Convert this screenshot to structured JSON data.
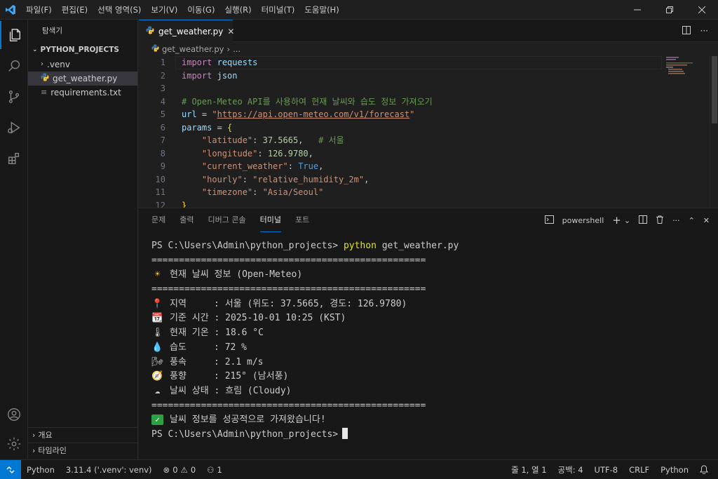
{
  "menu": [
    "파일(F)",
    "편집(E)",
    "선택 영역(S)",
    "보기(V)",
    "이동(G)",
    "실행(R)",
    "터미널(T)",
    "도움말(H)"
  ],
  "sidebar": {
    "title": "탐색기",
    "project": "PYTHON_PROJECTS",
    "items": [
      ".venv",
      "get_weather.py",
      "requirements.txt"
    ],
    "bottom": [
      "개요",
      "타임라인"
    ]
  },
  "editor": {
    "tab": "get_weather.py",
    "breadcrumb_file": "get_weather.py",
    "breadcrumb_more": "...",
    "lines": [
      [
        [
          "kw",
          "import"
        ],
        [
          "pl",
          " "
        ],
        [
          "id",
          "requests"
        ]
      ],
      [
        [
          "kw",
          "import"
        ],
        [
          "pl",
          " "
        ],
        [
          "id",
          "json"
        ]
      ],
      [],
      [
        [
          "cm",
          "# Open-Meteo API를 사용하여 현재 날씨와 습도 정보 가져오기"
        ]
      ],
      [
        [
          "id",
          "url"
        ],
        [
          "pl",
          " = "
        ],
        [
          "str",
          "\""
        ],
        [
          "url",
          "https://api.open-meteo.com/v1/forecast"
        ],
        [
          "str",
          "\""
        ]
      ],
      [
        [
          "id",
          "params"
        ],
        [
          "pl",
          " = "
        ],
        [
          "br",
          "{"
        ]
      ],
      [
        [
          "pl",
          "    "
        ],
        [
          "str",
          "\"latitude\""
        ],
        [
          "pl",
          ": "
        ],
        [
          "num",
          "37.5665"
        ],
        [
          "pl",
          ",   "
        ],
        [
          "cm",
          "# 서울"
        ]
      ],
      [
        [
          "pl",
          "    "
        ],
        [
          "str",
          "\"longitude\""
        ],
        [
          "pl",
          ": "
        ],
        [
          "num",
          "126.9780"
        ],
        [
          "pl",
          ","
        ]
      ],
      [
        [
          "pl",
          "    "
        ],
        [
          "str",
          "\"current_weather\""
        ],
        [
          "pl",
          ": "
        ],
        [
          "bool",
          "True"
        ],
        [
          "pl",
          ","
        ]
      ],
      [
        [
          "pl",
          "    "
        ],
        [
          "str",
          "\"hourly\""
        ],
        [
          "pl",
          ": "
        ],
        [
          "str",
          "\"relative_humidity_2m\""
        ],
        [
          "pl",
          ","
        ]
      ],
      [
        [
          "pl",
          "    "
        ],
        [
          "str",
          "\"timezone\""
        ],
        [
          "pl",
          ": "
        ],
        [
          "str",
          "\"Asia/Seoul\""
        ]
      ],
      [
        [
          "br",
          "}"
        ]
      ]
    ]
  },
  "panel": {
    "tabs": [
      "문제",
      "출력",
      "디버그 콘솔",
      "터미널",
      "포트"
    ],
    "active_tab": "터미널",
    "shell": "powershell"
  },
  "terminal": {
    "prompt": "PS C:\\Users\\Admin\\python_projects> ",
    "command": "python",
    "args": " get_weather.py",
    "separator": "==================================================",
    "header": "현재 날씨 정보 (Open-Meteo)",
    "rows": [
      {
        "icon": "📍",
        "text": "지역     : 서울 (위도: 37.5665, 경도: 126.9780)"
      },
      {
        "icon": "📆",
        "text": "기준 시간 : 2025-10-01 10:25 (KST)"
      },
      {
        "icon": "🌡",
        "text": "현재 기온 : 18.6 °C"
      },
      {
        "icon": "💧",
        "text": "습도     : 72 %"
      },
      {
        "icon": "🌬",
        "text": "풍속     : 2.1 m/s"
      },
      {
        "icon": "🧭",
        "text": "풍향     : 215° (남서풍)"
      },
      {
        "icon": "☁",
        "text": "날씨 상태 : 흐림 (Cloudy)"
      }
    ],
    "success": "날씨 정보를 성공적으로 가져왔습니다!",
    "final_prompt": "PS C:\\Users\\Admin\\python_projects>"
  },
  "status": {
    "language_left": "Python",
    "interpreter": "3.11.4 ('.venv': venv)",
    "errors": "0",
    "warnings": "0",
    "ports": "1",
    "position": "줄 1, 열 1",
    "spaces": "공백: 4",
    "encoding": "UTF-8",
    "eol": "CRLF",
    "language": "Python"
  }
}
